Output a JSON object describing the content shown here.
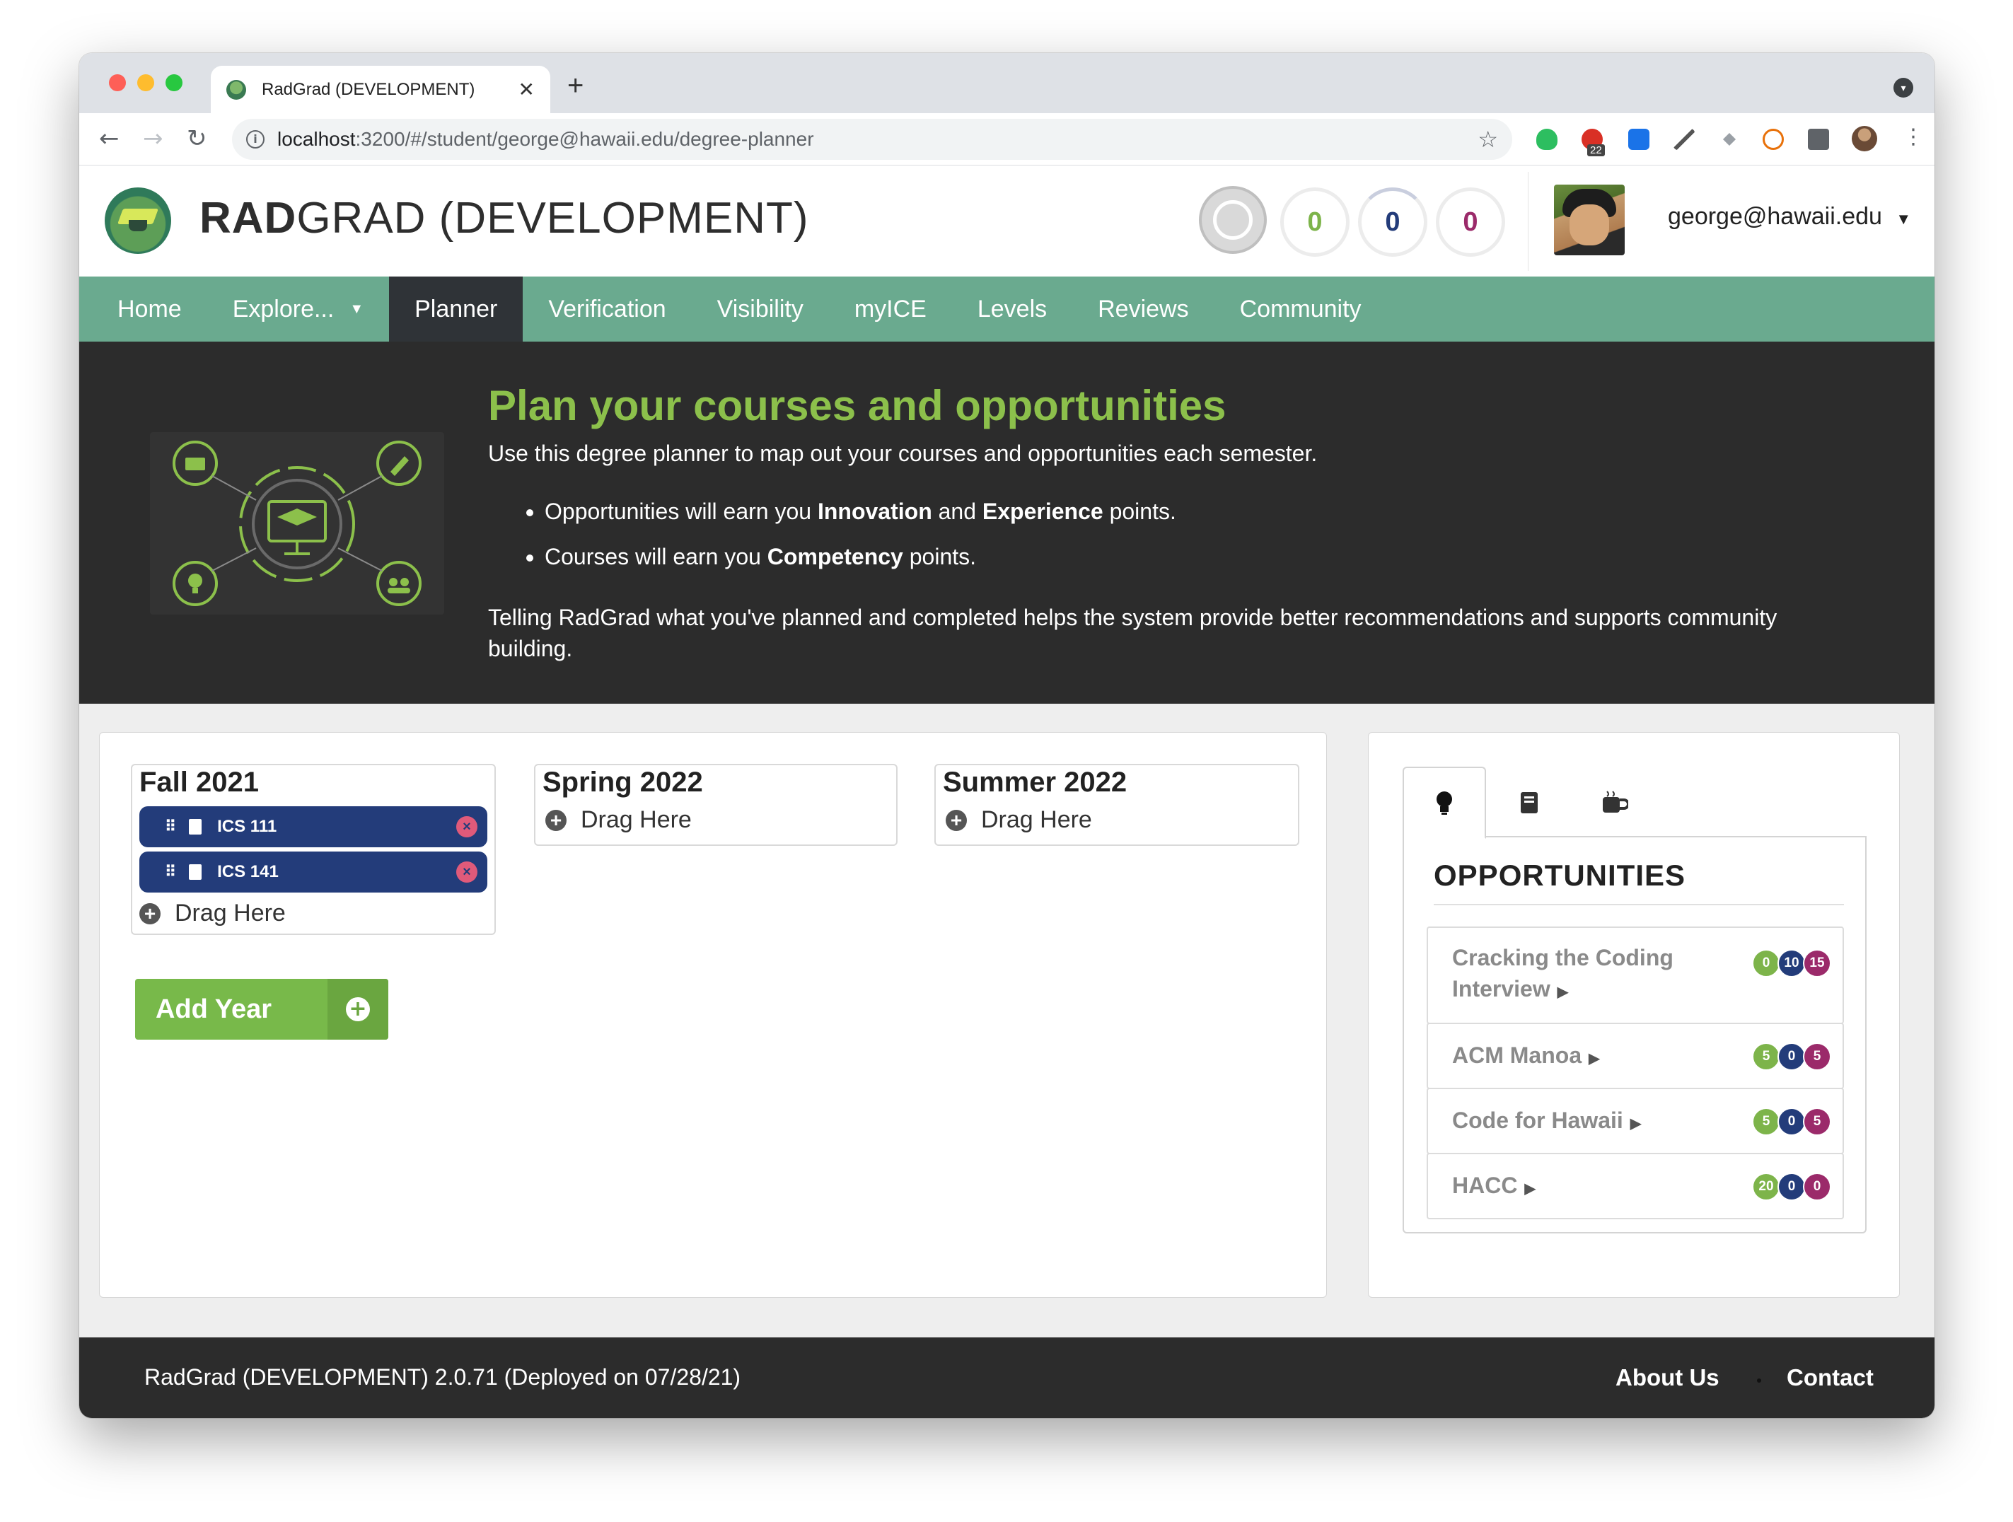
{
  "browser": {
    "tab_title": "RadGrad (DEVELOPMENT)",
    "url_host": "localhost",
    "url_rest": ":3200/#/student/george@hawaii.edu/degree-planner",
    "extension_badge": "22"
  },
  "header": {
    "title_bold": "RAD",
    "title_rest": "GRAD (DEVELOPMENT)",
    "ice": {
      "innovation": "0",
      "competency": "0",
      "experience": "0",
      "colors": {
        "innovation": "#7db44a",
        "competency": "#233c7a",
        "experience": "#9b2a6a"
      }
    },
    "user": "george@hawaii.edu"
  },
  "nav": {
    "items": [
      {
        "label": "Home"
      },
      {
        "label": "Explore..."
      },
      {
        "label": "Planner"
      },
      {
        "label": "Verification"
      },
      {
        "label": "Visibility"
      },
      {
        "label": "myICE"
      },
      {
        "label": "Levels"
      },
      {
        "label": "Reviews"
      },
      {
        "label": "Community"
      }
    ],
    "active": "Planner",
    "bar_color": "#6aaa8f"
  },
  "banner": {
    "title": "Plan your courses and opportunities",
    "intro": "Use this degree planner to map out your courses and opportunities each semester.",
    "bullet1_pre": "Opportunities will earn you ",
    "bullet1_b1": "Innovation",
    "bullet1_mid": " and ",
    "bullet1_b2": "Experience",
    "bullet1_post": " points.",
    "bullet2_pre": "Courses will earn you ",
    "bullet2_b": "Competency",
    "bullet2_post": " points.",
    "outro": "Telling RadGrad what you've planned and completed helps the system provide better recommendations and supports community building."
  },
  "planner": {
    "semesters": [
      {
        "title": "Fall 2021",
        "courses": [
          "ICS 111",
          "ICS 141"
        ],
        "drag": "Drag Here"
      },
      {
        "title": "Spring 2022",
        "courses": [],
        "drag": "Drag Here"
      },
      {
        "title": "Summer 2022",
        "courses": [],
        "drag": "Drag Here"
      }
    ],
    "add_year": "Add Year"
  },
  "sidebar": {
    "tabs": [
      "lightbulb-icon",
      "book-icon",
      "coffee-icon"
    ],
    "heading": "OPPORTUNITIES",
    "opportunities": [
      {
        "name_line1": "Cracking the Coding",
        "name_line2": "Interview",
        "i": "0",
        "c": "10",
        "e": "15"
      },
      {
        "name_line1": "ACM Manoa",
        "name_line2": "",
        "i": "5",
        "c": "0",
        "e": "5"
      },
      {
        "name_line1": "Code for Hawaii",
        "name_line2": "",
        "i": "5",
        "c": "0",
        "e": "5"
      },
      {
        "name_line1": "HACC",
        "name_line2": "",
        "i": "20",
        "c": "0",
        "e": "0"
      }
    ]
  },
  "footer": {
    "version": "RadGrad (DEVELOPMENT) 2.0.71 (Deployed on 07/28/21)",
    "about": "About Us",
    "contact": "Contact"
  }
}
